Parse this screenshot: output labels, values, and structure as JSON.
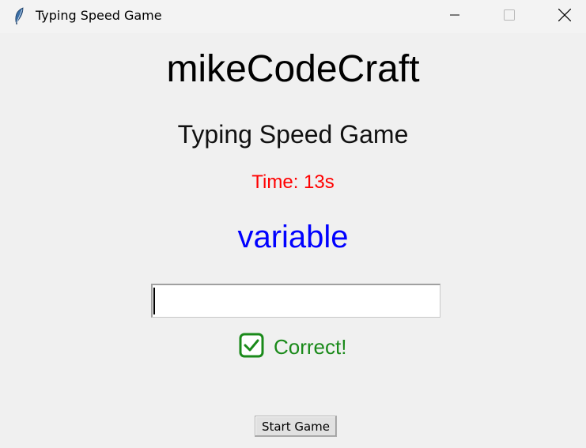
{
  "window": {
    "title": "Typing Speed Game",
    "icon": "feather-icon",
    "controls": [
      "minimize-icon",
      "maximize-icon",
      "close-icon"
    ]
  },
  "app": {
    "heading": "mikeCodeCraft",
    "game_title": "Typing Speed Game",
    "timer_text": "Time: 13s",
    "current_word": "variable",
    "input_value": "",
    "feedback": {
      "icon": "check-box-icon",
      "text": "Correct!"
    },
    "start_button_label": "Start Game"
  },
  "colors": {
    "timer": "#ff0000",
    "word": "#0000ff",
    "feedback": "#1a8a1a",
    "background": "#f0f0f0"
  }
}
